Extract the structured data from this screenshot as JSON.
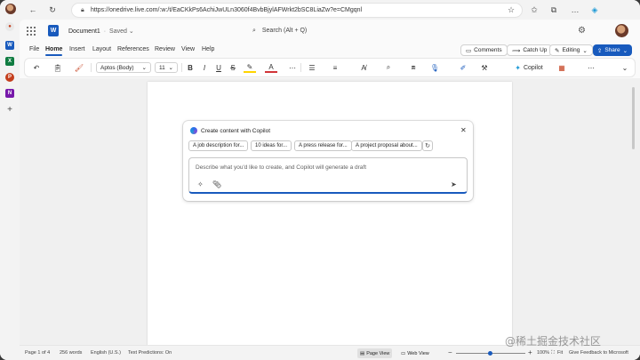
{
  "browser": {
    "url": "https://onedrive.live.com/:w:/t/EaCKkPs6AchiJwULn3060f4BvbBjylAFWrkt2bSC8LiaZw?e=CMgqnl"
  },
  "header": {
    "doc_name": "Document1",
    "separator": "·",
    "saved_status": "Saved",
    "saved_chevron": "⌄",
    "search_placeholder": "Search (Alt + Q)"
  },
  "menu": {
    "items": [
      "File",
      "Home",
      "Insert",
      "Layout",
      "References",
      "Review",
      "View",
      "Help"
    ],
    "active": "Home",
    "comments_label": "Comments",
    "catchup_label": "Catch Up",
    "editing_label": "Editing",
    "share_label": "Share"
  },
  "ribbon": {
    "font_name": "Aptos (Body)",
    "font_size": "11",
    "bold": "B",
    "italic": "I",
    "underline": "U",
    "copilot_label": "Copilot"
  },
  "copilot": {
    "title": "Create content with Copilot",
    "close": "✕",
    "chips": [
      "A job description for...",
      "10 ideas for...",
      "A press release for...",
      "A project proposal about..."
    ],
    "refresh": "↻",
    "placeholder": "Describe what you'd like to create, and Copilot will generate a draft",
    "send": "➤"
  },
  "status": {
    "page": "Page 1 of 4",
    "words": "256 words",
    "language": "English (U.S.)",
    "predictions": "Text Predictions: On",
    "page_view": "Page View",
    "web_view": "Web View",
    "zoom": "100%",
    "fit": "Fit",
    "feedback": "Give Feedback to Microsoft"
  },
  "watermark": "@稀土掘金技术社区",
  "colors": {
    "accent": "#185abd",
    "word_blue": "#185abd",
    "excel_green": "#107c41",
    "ppt_orange": "#c43e1c",
    "onenote_purple": "#7719aa"
  }
}
